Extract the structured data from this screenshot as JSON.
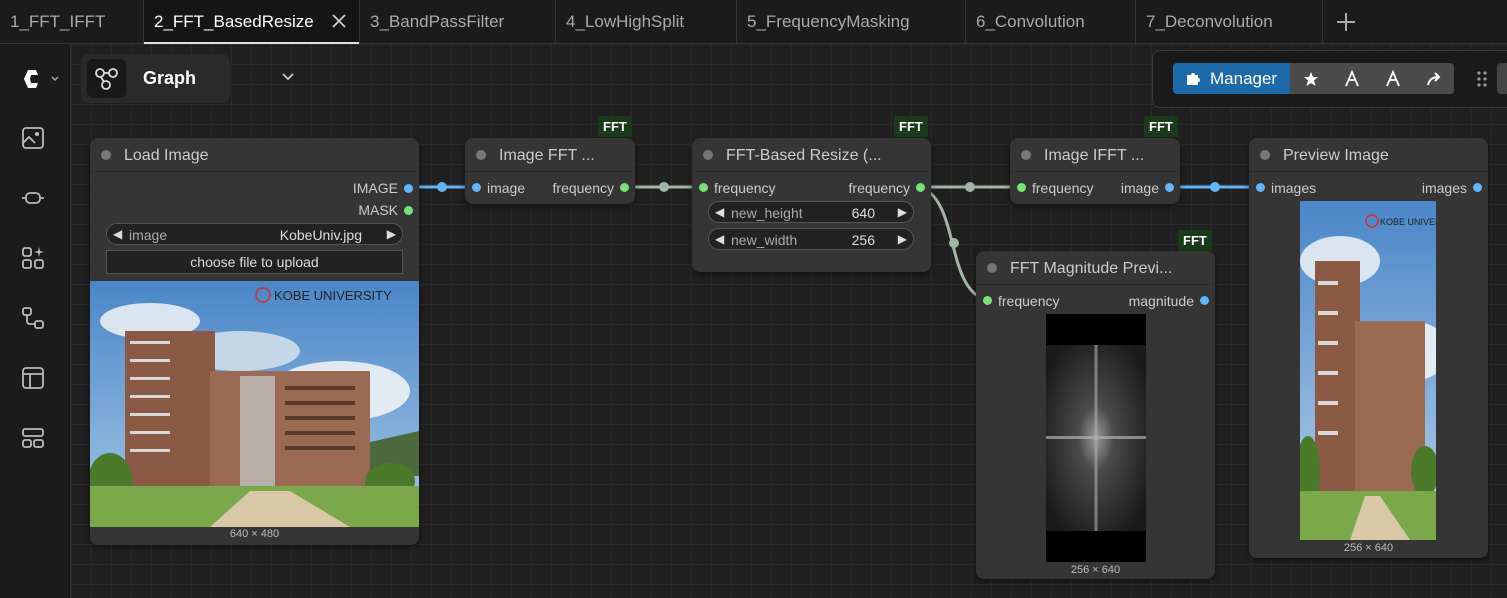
{
  "tabs": [
    {
      "label": "1_FFT_IFFT"
    },
    {
      "label": "2_FFT_BasedResize"
    },
    {
      "label": "3_BandPassFilter"
    },
    {
      "label": "4_LowHighSplit"
    },
    {
      "label": "5_FrequencyMasking"
    },
    {
      "label": "6_Convolution"
    },
    {
      "label": "7_Deconvolution"
    }
  ],
  "graph_menu": {
    "label": "Graph"
  },
  "toolbar": {
    "manager_label": "Manager"
  },
  "nodes": {
    "load_image": {
      "title": "Load Image",
      "out_image": "IMAGE",
      "out_mask": "MASK",
      "widget_label": "image",
      "widget_value": "KobeUniv.jpg",
      "upload_label": "choose file to upload",
      "logo_text": "KOBE UNIVERSITY",
      "size": "640 × 480"
    },
    "image_fft": {
      "title": "Image FFT ...",
      "badge": "FFT",
      "in_image": "image",
      "out_frequency": "frequency"
    },
    "fft_resize": {
      "title": "FFT-Based Resize (...",
      "badge": "FFT",
      "in_frequency": "frequency",
      "out_frequency": "frequency",
      "height_label": "new_height",
      "height_value": "640",
      "width_label": "new_width",
      "width_value": "256"
    },
    "image_ifft": {
      "title": "Image IFFT ...",
      "badge": "FFT",
      "in_frequency": "frequency",
      "out_image": "image"
    },
    "preview_image": {
      "title": "Preview Image",
      "in_images": "images",
      "out_images": "images",
      "logo_text": "KOBE UNIVERSITY",
      "size": "256 × 640"
    },
    "fft_magnitude": {
      "title": "FFT Magnitude Previ...",
      "badge": "FFT",
      "in_frequency": "frequency",
      "out_magnitude": "magnitude",
      "size": "256 × 640"
    }
  },
  "colors": {
    "image_wire": "#64b5f6",
    "frequency_wire": "#a3b5a3",
    "frequency_slot": "#7ae07a",
    "manager_blue": "#1e6aa8"
  }
}
